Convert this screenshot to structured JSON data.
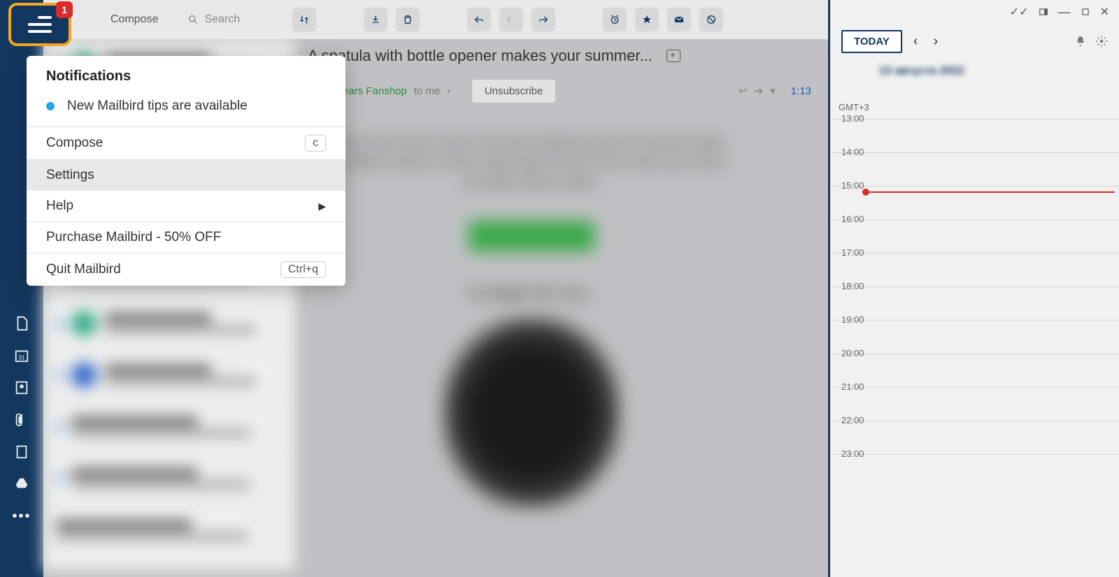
{
  "hamburger": {
    "badge": "1"
  },
  "topbar": {
    "compose": "Compose",
    "search_placeholder": "Search"
  },
  "email": {
    "subject": "A spatula with bottle opener makes your summer...",
    "sender": "icago Bears Fanshop",
    "to": "to me",
    "unsubscribe": "Unsubscribe",
    "time": "1:13",
    "body_heading": "You Might Also Like..."
  },
  "calendar": {
    "today": "TODAY",
    "tz": "GMT+3",
    "date": "13 августа 2022",
    "hours": [
      "13:00",
      "14:00",
      "15:00",
      "16:00",
      "17:00",
      "18:00",
      "19:00",
      "20:00",
      "21:00",
      "22:00",
      "23:00"
    ],
    "now_index": 2
  },
  "menu": {
    "header": "Notifications",
    "notification": "New Mailbird tips are available",
    "items": [
      {
        "label": "Compose",
        "shortcut": "c"
      },
      {
        "label": "Settings",
        "hover": true
      },
      {
        "label": "Help",
        "arrow": true
      },
      {
        "label": "Purchase Mailbird - 50% OFF"
      },
      {
        "label": "Quit Mailbird",
        "shortcut": "Ctrl+q"
      }
    ]
  }
}
